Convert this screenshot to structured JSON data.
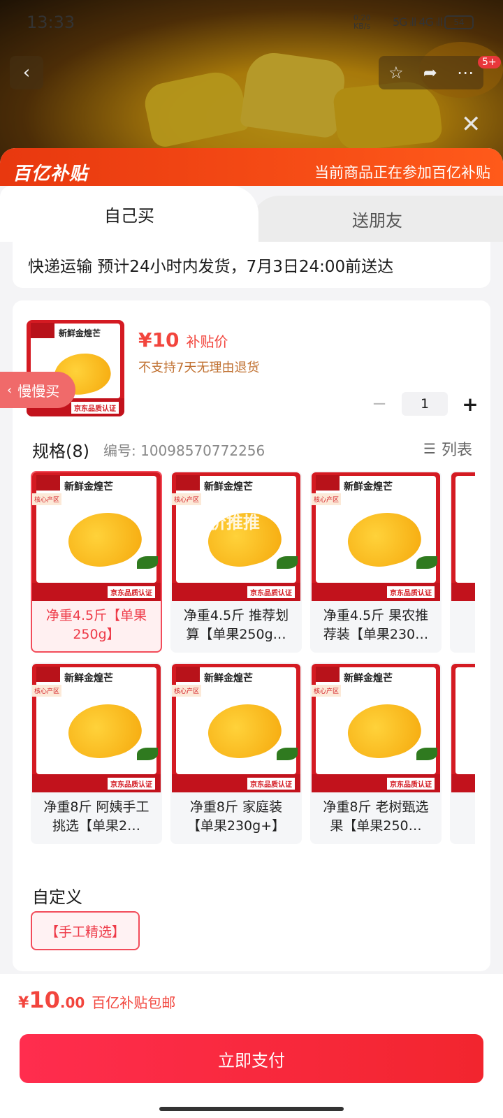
{
  "status": {
    "time": "13:33",
    "net_speed": "0.20\nKB/s",
    "signal": "5G ᵢll 4G ᵢll",
    "battery": "54"
  },
  "header": {
    "badge": "5+"
  },
  "banner": {
    "brand": "百亿补贴",
    "message": "当前商品正在参加百亿补贴"
  },
  "tabs": {
    "self": "自己买",
    "gift": "送朋友"
  },
  "shipping": {
    "text": "快递运输 预计24小时内发货，7月3日24:00前送达"
  },
  "product": {
    "price": "¥10",
    "price_tag": "补贴价",
    "no_return": "不支持7天无理由退货",
    "quantity": "1",
    "thumb_title": "新鲜金煌芒",
    "thumb_cert": "京东品质认证"
  },
  "slow_buy": {
    "label": "慢慢买"
  },
  "spec": {
    "title": "规格(8)",
    "code": "编号: 10098570772256",
    "list_label": "列表",
    "watermark": "好价推推",
    "items": [
      {
        "label": "净重4.5斤【单果250g】",
        "selected": true
      },
      {
        "label": "净重4.5斤 推荐划算【单果250g…",
        "selected": false
      },
      {
        "label": "净重4.5斤 果农推荐装【单果230…",
        "selected": false
      },
      {
        "label": "净重8斤 阿姨手工挑选【单果2…",
        "selected": false
      },
      {
        "label": "净重8斤 家庭装【单果230g+】",
        "selected": false
      },
      {
        "label": "净重8斤 老树甄选果【单果250…",
        "selected": false
      }
    ],
    "img_title": "新鲜金煌芒",
    "img_tag": "核心产区",
    "img_cert": "京东品质认证"
  },
  "custom": {
    "title": "自定义",
    "chip": "【手工精选】"
  },
  "footer": {
    "currency": "¥",
    "int": "10",
    "dec": ".00",
    "note": "百亿补贴包邮",
    "pay": "立即支付"
  }
}
